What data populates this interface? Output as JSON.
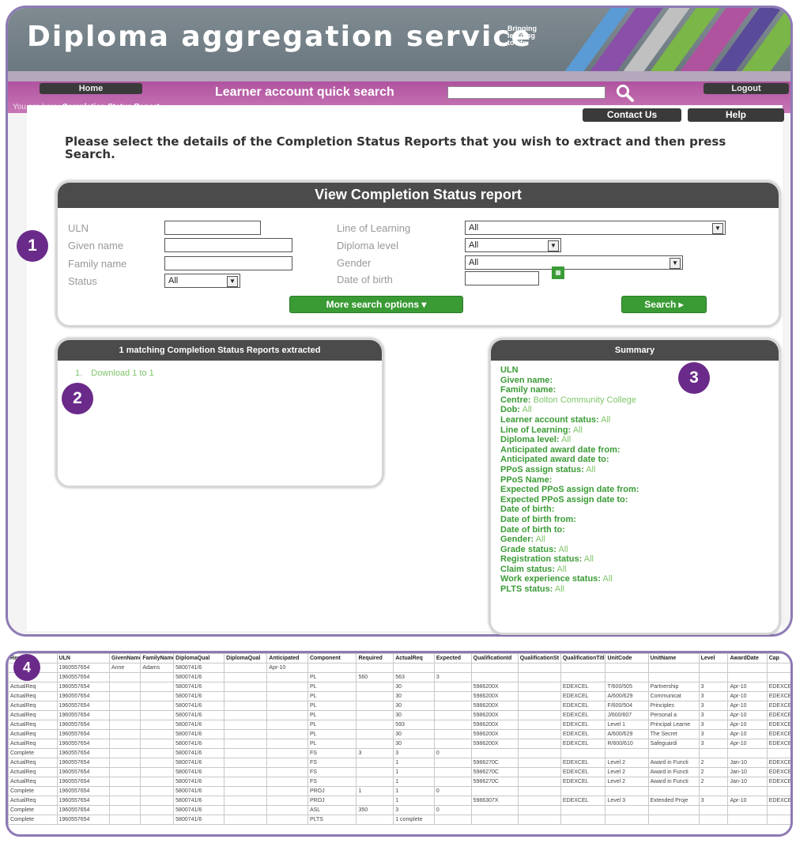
{
  "banner": {
    "title": "Diploma  aggregation  service",
    "tagline": [
      "Bringing",
      "learning",
      "to life"
    ]
  },
  "nav": {
    "home_label": "Home",
    "logout_label": "Logout",
    "quick_search_label": "Learner account quick search",
    "breadcrumb_prefix": "You are here:",
    "breadcrumb_page": "Completion Status Report"
  },
  "top_buttons": {
    "contact": "Contact Us",
    "help": "Help"
  },
  "intro": "Please select the details of the Completion Status Reports that you wish to extract and then press Search.",
  "search_panel": {
    "title": "View Completion Status report",
    "uln_label": "ULN",
    "given_label": "Given name",
    "family_label": "Family name",
    "status_label": "Status",
    "status_value": "All",
    "line_label": "Line of Learning",
    "line_value": "All",
    "level_label": "Diploma level",
    "level_value": "All",
    "gender_label": "Gender",
    "gender_value": "All",
    "dob_label": "Date of birth",
    "more_label": "More search options",
    "search_label": "Search"
  },
  "results_panel": {
    "title": "1 matching Completion Status Reports extracted",
    "item_index": "1.",
    "item_label": "Download 1 to 1"
  },
  "summary_panel": {
    "title": "Summary",
    "lines": [
      {
        "k": "ULN",
        "v": ""
      },
      {
        "k": "Given name:",
        "v": ""
      },
      {
        "k": "Family name:",
        "v": ""
      },
      {
        "k": "Centre:",
        "v": "Bolton Community College"
      },
      {
        "k": "Dob:",
        "v": "All"
      },
      {
        "k": "Learner account status:",
        "v": "All"
      },
      {
        "k": "Line of Learning:",
        "v": "All"
      },
      {
        "k": "Diploma level:",
        "v": "All"
      },
      {
        "k": "Anticipated award date from:",
        "v": ""
      },
      {
        "k": "Anticipated award date to:",
        "v": ""
      },
      {
        "k": "PPoS assign status:",
        "v": "All"
      },
      {
        "k": "PPoS Name:",
        "v": ""
      },
      {
        "k": "Expected PPoS assign date from:",
        "v": ""
      },
      {
        "k": "Expected PPoS assign date to:",
        "v": ""
      },
      {
        "k": "Date of birth:",
        "v": ""
      },
      {
        "k": "Date of birth from:",
        "v": ""
      },
      {
        "k": "Date of birth to:",
        "v": ""
      },
      {
        "k": "Gender:",
        "v": "All"
      },
      {
        "k": "Grade status:",
        "v": "All"
      },
      {
        "k": "Registration status:",
        "v": "All"
      },
      {
        "k": "Claim status:",
        "v": "All"
      },
      {
        "k": "Work experience status:",
        "v": "All"
      },
      {
        "k": "PLTS status:",
        "v": "All"
      }
    ]
  },
  "badges": [
    "1",
    "2",
    "3",
    "4"
  ],
  "spreadsheet": {
    "headers": [
      "Report",
      "ULN",
      "GivenName",
      "FamilyName",
      "DiplomaQual",
      "DiplomaQual",
      "Anticipated",
      "Component",
      "Required",
      "ActualReq",
      "Expected",
      "QualificationId",
      "QualificationSt",
      "QualificationTitle",
      "UnitCode",
      "UnitName",
      "Level",
      "AwardDate",
      "Cap"
    ],
    "rows": [
      [
        "",
        "1960557654",
        "Anne",
        "Adams",
        "5800741/6",
        "",
        "Apr-10",
        "",
        "",
        "",
        "",
        "",
        "",
        "",
        "",
        "",
        "",
        "",
        ""
      ],
      [
        "",
        "1960557654",
        "",
        "",
        "5800741/6",
        "",
        "",
        "PL",
        "560",
        "563",
        "3",
        "",
        "",
        "",
        "",
        "",
        "",
        "",
        ""
      ],
      [
        "ActualReq",
        "1960557654",
        "",
        "",
        "5800741/6",
        "",
        "",
        "PL",
        "",
        "30",
        "",
        "5986200X",
        "",
        "EDEXCEL",
        "T/600/505",
        "Partnership",
        "3",
        "Apr-10",
        "EDEXCEL"
      ],
      [
        "ActualReq",
        "1960557654",
        "",
        "",
        "5800741/6",
        "",
        "",
        "PL",
        "",
        "30",
        "",
        "5986200X",
        "",
        "EDEXCEL",
        "A/600/629",
        "Communicat",
        "3",
        "Apr-10",
        "EDEXCEL"
      ],
      [
        "ActualReq",
        "1960557654",
        "",
        "",
        "5800741/6",
        "",
        "",
        "PL",
        "",
        "30",
        "",
        "5986200X",
        "",
        "EDEXCEL",
        "F/600/504",
        "Principles",
        "3",
        "Apr-10",
        "EDEXCEL"
      ],
      [
        "ActualReq",
        "1960557654",
        "",
        "",
        "5800741/6",
        "",
        "",
        "PL",
        "",
        "30",
        "",
        "5986200X",
        "",
        "EDEXCEL",
        "J/600/607",
        "Personal a",
        "3",
        "Apr-10",
        "EDEXCEL"
      ],
      [
        "ActualReq",
        "1960557654",
        "",
        "",
        "5800741/6",
        "",
        "",
        "PL",
        "",
        "593",
        "",
        "5986200X",
        "",
        "EDEXCEL",
        "Level 1",
        "Principal Learne",
        "3",
        "Apr-10",
        "EDEXCEL"
      ],
      [
        "ActualReq",
        "1960557654",
        "",
        "",
        "5800741/6",
        "",
        "",
        "PL",
        "",
        "30",
        "",
        "5986200X",
        "",
        "EDEXCEL",
        "A/600/629",
        "The Secret",
        "3",
        "Apr-10",
        "EDEXCEL"
      ],
      [
        "ActualReq",
        "1960557654",
        "",
        "",
        "5800741/6",
        "",
        "",
        "PL",
        "",
        "30",
        "",
        "5986200X",
        "",
        "EDEXCEL",
        "R/600/610",
        "Safeguardi",
        "3",
        "Apr-10",
        "EDEXCEL"
      ],
      [
        "Complete",
        "1960557654",
        "",
        "",
        "5800741/6",
        "",
        "",
        "FS",
        "3",
        "3",
        "0",
        "",
        "",
        "",
        "",
        "",
        "",
        "",
        ""
      ],
      [
        "ActualReq",
        "1960557654",
        "",
        "",
        "5800741/6",
        "",
        "",
        "FS",
        "",
        "1",
        "",
        "5986270C",
        "",
        "EDEXCEL",
        "Level 2",
        "Award in Functi",
        "2",
        "Jan-10",
        "EDEXCEL"
      ],
      [
        "ActualReq",
        "1960557654",
        "",
        "",
        "5800741/6",
        "",
        "",
        "FS",
        "",
        "1",
        "",
        "5986270C",
        "",
        "EDEXCEL",
        "Level 2",
        "Award in Functi",
        "2",
        "Jan-10",
        "EDEXCEL"
      ],
      [
        "ActualReq",
        "1960557654",
        "",
        "",
        "5800741/6",
        "",
        "",
        "FS",
        "",
        "1",
        "",
        "5986270C",
        "",
        "EDEXCEL",
        "Level 2",
        "Award in Functi",
        "2",
        "Jan-10",
        "EDEXCEL"
      ],
      [
        "Complete",
        "1960557654",
        "",
        "",
        "5800741/6",
        "",
        "",
        "PROJ",
        "1",
        "1",
        "0",
        "",
        "",
        "",
        "",
        "",
        "",
        "",
        ""
      ],
      [
        "ActualReq",
        "1960557654",
        "",
        "",
        "5800741/6",
        "",
        "",
        "PROJ",
        "",
        "1",
        "",
        "5986307X",
        "",
        "EDEXCEL",
        "Level 3",
        "Extended Proje",
        "3",
        "Apr-10",
        "EDEXCEL"
      ],
      [
        "Complete",
        "1960557654",
        "",
        "",
        "5800741/6",
        "",
        "",
        "ASL",
        "350",
        "3",
        "0",
        "",
        "",
        "",
        "",
        "",
        "",
        "",
        ""
      ],
      [
        "Complete",
        "1960557654",
        "",
        "",
        "5800741/6",
        "",
        "",
        "PLTS",
        "",
        "1 complete",
        "",
        "",
        "",
        "",
        "",
        "",
        "",
        "",
        ""
      ]
    ]
  }
}
